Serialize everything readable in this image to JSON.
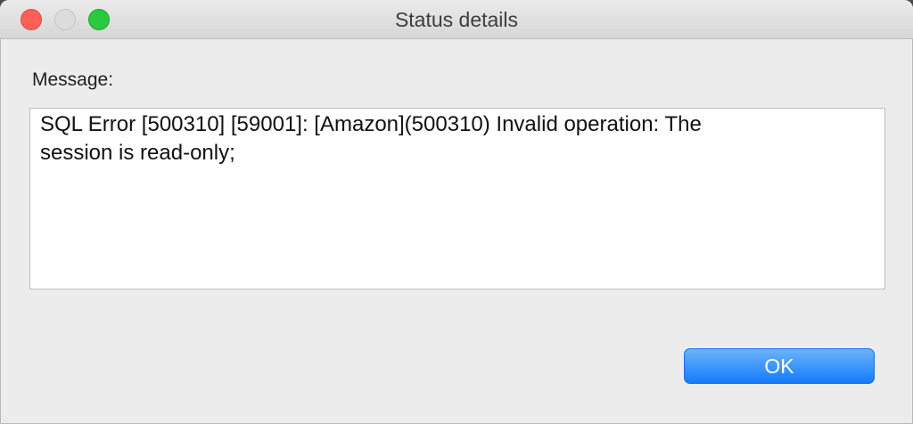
{
  "window": {
    "title": "Status details"
  },
  "dialog": {
    "message_label": "Message:",
    "message_text": "SQL Error [500310] [59001]: [Amazon](500310) Invalid operation: The\nsession is read-only;",
    "ok_label": "OK"
  },
  "colors": {
    "close": "#fe5f57",
    "minimize": "#dcdcdc",
    "maximize": "#29c940",
    "accent": "#147bfa"
  }
}
